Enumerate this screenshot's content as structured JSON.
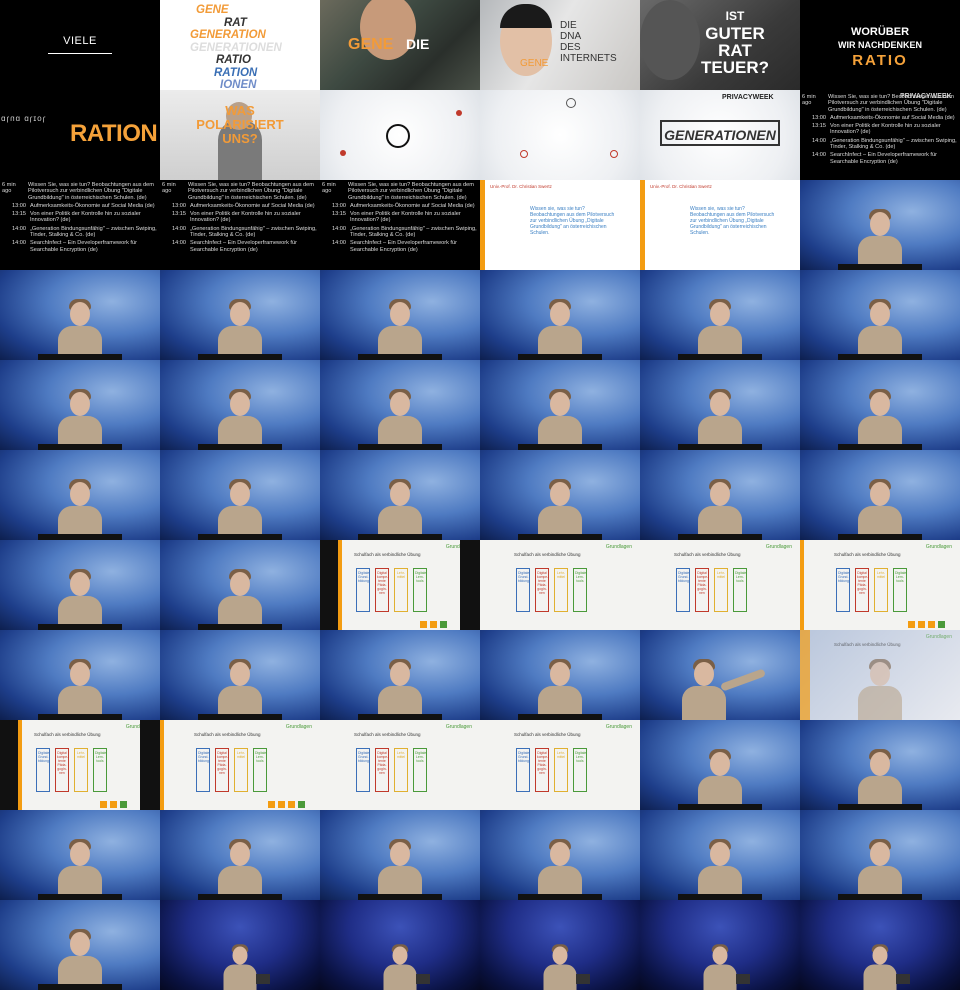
{
  "intro": {
    "viele": "VIELE",
    "wordstack": [
      "GENE",
      "RAT",
      "GENERATION",
      "GENERATIONEN",
      "RATIO",
      "RATION",
      "IONEN"
    ],
    "gene_die": [
      "GENE",
      "DIE"
    ],
    "dna": [
      "DIE",
      "DNA",
      "DES",
      "INTERNETS",
      "GENE"
    ],
    "guter_rat": [
      "IST",
      "GUTER",
      "RAT",
      "TEUER?"
    ],
    "woruber": [
      "WORÜBER",
      "WIR NACHDENKEN",
      "RATIO"
    ],
    "ration": "RATION",
    "polarisiert": [
      "WAS",
      "POLARISIERT",
      "UNS?"
    ],
    "generationen": "GENERATIONEN",
    "privacyweek": "PRIVACYWEEK"
  },
  "schedule": {
    "ago": "6 min ago",
    "rows": [
      {
        "time": "",
        "title": "Wissen Sie, was sie tun? Beobachtungen aus dem Pilotversuch zur verbindlichen Übung \"Digitale Grundbildung\" in österreichischen Schulen. (de)",
        "room": "Saal 1 with Christian Swertz"
      },
      {
        "time": "13:00",
        "title": "Aufmerksamkeits-Ökonomie auf Social Media (de)",
        "room": "Saal 2 with Annika Wolf"
      },
      {
        "time": "13:15",
        "title": "Von einer Politik der Kontrolle hin zu sozialer Innovation? (de)",
        "room": "Saal 1 with Astrid Mager"
      },
      {
        "time": "14:00",
        "title": "„Generation Bindungsunfähig\" – zwischen Swiping, Tinder, Stalking & Co. (de)",
        "room": "Saal 1 with Sandra Legat"
      },
      {
        "time": "14:00",
        "title": "SearchInfect – Ein Developerframework für Searchable Encryption (de)",
        "room": "Saal 2 with Michael Fenzl"
      }
    ]
  },
  "slide": {
    "speaker": "Univ.-Prof. Dr. Christian Swertz",
    "title": "Wissen sie, was sie tun? Beobachtungen aus dem Pilotversuch zur verbindlichen Übung „Digitale Grundbildung\" an österreichischen Schulen."
  },
  "grundlagen": {
    "header": "Grundlagen",
    "title": "Schulfach als verbindliche Übung",
    "cols": [
      "Digitale Grund-bildung",
      "Digital kompe-tente Päda-gogIn-nen",
      "Lehr-mittel",
      "Digitale Lern-tools"
    ]
  },
  "colors": {
    "accent_orange": "#f39c12",
    "slide_red": "#c0392b",
    "slide_blue": "#3b6fb8",
    "slide_green": "#4a9a3a",
    "slide_yellow": "#e0b030"
  }
}
